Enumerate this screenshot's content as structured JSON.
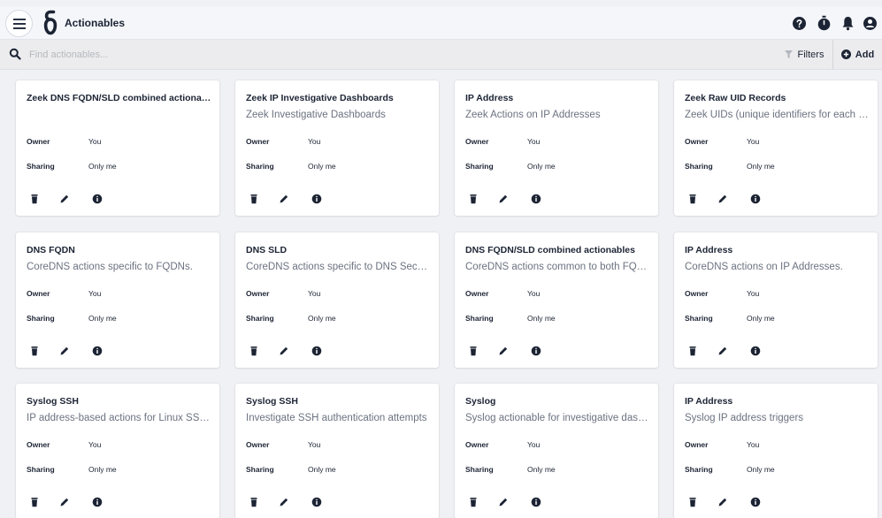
{
  "header": {
    "title": "Actionables"
  },
  "search": {
    "placeholder": "Find actionables..."
  },
  "toolbar": {
    "filters_label": "Filters",
    "add_label": "Add"
  },
  "labels": {
    "owner": "Owner",
    "sharing": "Sharing"
  },
  "cards": [
    {
      "title": "Zeek DNS FQDN/SLD combined actionables",
      "description": "",
      "owner": "You",
      "sharing": "Only me"
    },
    {
      "title": "Zeek IP Investigative Dashboards",
      "description": "Zeek Investigative Dashboards",
      "owner": "You",
      "sharing": "Only me"
    },
    {
      "title": "IP Address",
      "description": "Zeek Actions on IP Addresses",
      "owner": "You",
      "sharing": "Only me"
    },
    {
      "title": "Zeek Raw UID Records",
      "description": "Zeek UIDs (unique identifiers for each flow)",
      "owner": "You",
      "sharing": "Only me"
    },
    {
      "title": "DNS FQDN",
      "description": "CoreDNS actions specific to FQDNs.",
      "owner": "You",
      "sharing": "Only me"
    },
    {
      "title": "DNS SLD",
      "description": "CoreDNS actions specific to DNS Second Level Domains.",
      "owner": "You",
      "sharing": "Only me"
    },
    {
      "title": "DNS FQDN/SLD combined actionables",
      "description": "CoreDNS actions common to both FQDNs and SLDs",
      "owner": "You",
      "sharing": "Only me"
    },
    {
      "title": "IP Address",
      "description": "CoreDNS actions on IP Addresses.",
      "owner": "You",
      "sharing": "Only me"
    },
    {
      "title": "Syslog SSH",
      "description": "IP address-based actions for Linux SSH logs",
      "owner": "You",
      "sharing": "Only me"
    },
    {
      "title": "Syslog SSH",
      "description": "Investigate SSH authentication attempts",
      "owner": "You",
      "sharing": "Only me"
    },
    {
      "title": "Syslog",
      "description": "Syslog actionable for investigative dashboards",
      "owner": "You",
      "sharing": "Only me"
    },
    {
      "title": "IP Address",
      "description": "Syslog IP address triggers",
      "owner": "You",
      "sharing": "Only me"
    }
  ],
  "icons": {
    "menu": "hamburger-menu-icon",
    "logo": "app-logo",
    "help": "help-circle-icon",
    "timer": "stopwatch-icon",
    "notifications": "bell-icon",
    "account": "account-circle-icon",
    "search": "search-icon",
    "filter": "filter-icon",
    "add": "plus-circle-icon",
    "delete": "trash-icon",
    "edit": "pencil-icon",
    "info": "info-circle-icon"
  },
  "colors": {
    "brand": "#1c2434",
    "topbar_bg": "#f4f6fa",
    "searchbar_bg": "#ececee",
    "page_bg": "#f0f1f5",
    "card_bg": "#ffffff",
    "muted_text": "#6b7280"
  }
}
